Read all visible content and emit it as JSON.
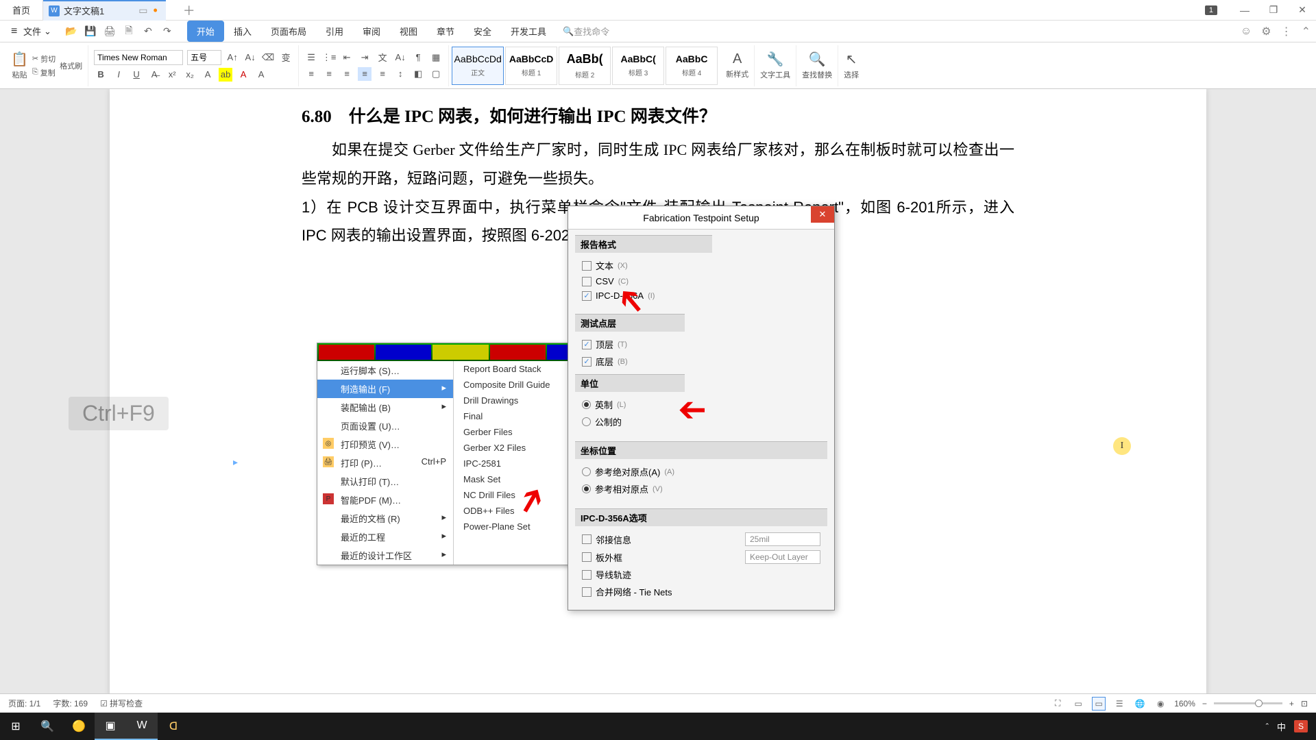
{
  "titlebar": {
    "home_tab": "首页",
    "doc_tab": "文字文稿1",
    "doc_icon": "W",
    "badge": "1"
  },
  "menubar": {
    "file_label": "文件",
    "tabs": [
      "开始",
      "插入",
      "页面布局",
      "引用",
      "审阅",
      "视图",
      "章节",
      "安全",
      "开发工具"
    ],
    "active_tab_index": 0,
    "search_placeholder": "查找命令"
  },
  "ribbon": {
    "paste_label": "粘贴",
    "cut_label": "剪切",
    "copy_label": "复制",
    "format_painter": "格式刷",
    "font_name": "Times New Roman",
    "font_size": "五号",
    "styles": [
      {
        "preview": "AaBbCcDd",
        "name": "正文"
      },
      {
        "preview": "AaBbCcD",
        "name": "标题 1"
      },
      {
        "preview": "AaBb(",
        "name": "标题 2"
      },
      {
        "preview": "AaBbC(",
        "name": "标题 3"
      },
      {
        "preview": "AaBbC",
        "name": "标题 4"
      }
    ],
    "new_style": "新样式",
    "text_tool": "文字工具",
    "find_replace": "查找替换",
    "select": "选择"
  },
  "document": {
    "heading": "6.80　什么是 IPC 网表，如何进行输出 IPC 网表文件？",
    "para1": "如果在提交 Gerber 文件给生产厂家时，同时生成 IPC 网表给厂家核对，那么在制板时就可以检查出一些常规的开路，短路问题，可避免一些损失。",
    "para2a": "1）在 PCB 设计交互界面中，执行菜单栏命令\"文件-装配输出-",
    "para2_underlined": "Tespoint",
    "para2b": " Report\"，如图 6-201所示，进入 IPC 网表的输出设置界面，按照图 6-202 所示进行相关设置，之后输出即可。"
  },
  "context_menu": {
    "left_items": [
      {
        "label": "运行脚本 (S)…",
        "arrow": false
      },
      {
        "label": "制造输出 (F)",
        "arrow": true,
        "hl": true
      },
      {
        "label": "装配输出 (B)",
        "arrow": true
      },
      {
        "label": "页面设置 (U)…",
        "arrow": false
      },
      {
        "label": "打印预览 (V)…",
        "arrow": false,
        "icon": true
      },
      {
        "label": "打印 (P)…",
        "shortcut": "Ctrl+P",
        "arrow": false,
        "icon": true
      },
      {
        "label": "默认打印 (T)…",
        "arrow": false
      },
      {
        "label": "智能PDF (M)…",
        "arrow": false,
        "icon": true
      },
      {
        "label": "最近的文档 (R)",
        "arrow": true
      },
      {
        "label": "最近的工程",
        "arrow": true
      },
      {
        "label": "最近的设计工作区",
        "arrow": true
      }
    ],
    "right_items": [
      "Report Board Stack",
      "Composite Drill Guide",
      "Drill Drawings",
      "Final",
      "Gerber Files",
      "Gerber X2 Files",
      "IPC-2581",
      "Mask Set",
      "NC Drill Files",
      "ODB++ Files",
      "Power-Plane Set"
    ]
  },
  "dialog": {
    "title": "Fabrication Testpoint Setup",
    "sections": {
      "report_format": {
        "title": "报告格式",
        "items": [
          {
            "label": "文本",
            "key": "(X)",
            "checked": false
          },
          {
            "label": "CSV",
            "key": "(C)",
            "checked": false
          },
          {
            "label": "IPC-D-356A",
            "key": "(I)",
            "checked": true
          }
        ]
      },
      "test_layer": {
        "title": "测试点层",
        "items": [
          {
            "label": "顶层",
            "key": "(T)",
            "checked": true
          },
          {
            "label": "底层",
            "key": "(B)",
            "checked": true
          }
        ]
      },
      "unit": {
        "title": "单位",
        "items": [
          {
            "label": "英制",
            "key": "(L)",
            "selected": true
          },
          {
            "label": "公制的",
            "key": "",
            "selected": false
          }
        ]
      },
      "coord": {
        "title": "坐标位置",
        "items": [
          {
            "label": "参考绝对原点(A)",
            "key": "(A)",
            "selected": false
          },
          {
            "label": "参考相对原点",
            "key": "(V)",
            "selected": true
          }
        ]
      },
      "ipc_opts": {
        "title": "IPC-D-356A选项",
        "items": [
          {
            "label": "邻接信息",
            "checked": false,
            "input": "25mil"
          },
          {
            "label": "板外框",
            "checked": false,
            "input": "Keep-Out Layer"
          },
          {
            "label": "导线轨迹",
            "checked": false
          },
          {
            "label": "合并网络 - Tie Nets",
            "checked": false
          }
        ]
      }
    }
  },
  "hint_overlay": "Ctrl+F9",
  "statusbar": {
    "page": "页面: 1/1",
    "words": "字数: 169",
    "spell": "拼写检查",
    "zoom": "160%"
  },
  "tray": {
    "ime": "中"
  }
}
